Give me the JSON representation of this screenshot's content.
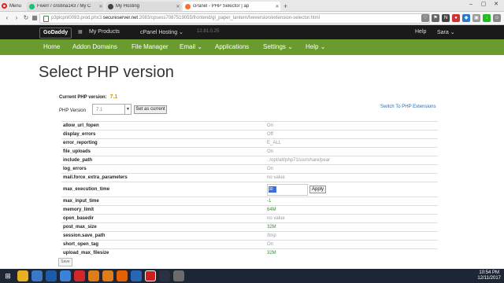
{
  "browser": {
    "menu_label": "Menu",
    "tabs": [
      {
        "label": "Fiverr / cristina143 / My C",
        "color": "#1dbf73",
        "active": false
      },
      {
        "label": "My Hosting",
        "color": "#444444",
        "active": false
      },
      {
        "label": "cPanel - PHP Selector | ap",
        "color": "#ff6c2c",
        "active": true
      }
    ],
    "url_prefix": "p3plcpnl0093.prod.phx3.",
    "url_host": "secureserver.net",
    "url_rest": ":2083/cpsess7087519055/frontend/gl_paper_lantern/lveversion/extension-selector.html"
  },
  "cpanel_top": {
    "logo": "GoDaddy",
    "my_products": "My Products",
    "hosting": "cPanel Hosting",
    "version": "12.81.0.25",
    "help": "Help",
    "user": "Sara"
  },
  "nav": [
    "Home",
    "Addon Domains",
    "File Manager",
    "Email",
    "Applications",
    "Settings",
    "Help"
  ],
  "page": {
    "title": "Select PHP version",
    "current_label": "Current PHP version:",
    "current_value": "7.1",
    "php_version_label": "PHP Version",
    "php_version_selected": "7.1",
    "set_current_label": "Set as current",
    "switch_link": "Switch To PHP Extensions",
    "apply_label": "Apply",
    "editing_value": "30",
    "save_label": "Save"
  },
  "options": [
    {
      "name": "allow_url_fopen",
      "value": "On"
    },
    {
      "name": "display_errors",
      "value": "Off"
    },
    {
      "name": "error_reporting",
      "value": "E_ALL"
    },
    {
      "name": "file_uploads",
      "value": "On"
    },
    {
      "name": "include_path",
      "value": ".:/opt/alt/php71/usr/share/pear"
    },
    {
      "name": "log_errors",
      "value": "On"
    },
    {
      "name": "mail.force_extra_parameters",
      "value": "no value"
    },
    {
      "name": "max_execution_time",
      "value": ""
    },
    {
      "name": "max_input_time",
      "value": "-1"
    },
    {
      "name": "memory_limit",
      "value": "64M"
    },
    {
      "name": "open_basedir",
      "value": "no value"
    },
    {
      "name": "post_max_size",
      "value": "32M"
    },
    {
      "name": "session.save_path",
      "value": "/tmp"
    },
    {
      "name": "short_open_tag",
      "value": "On"
    },
    {
      "name": "upload_max_filesize",
      "value": "32M"
    }
  ],
  "taskbar": {
    "time": "10:54 PM",
    "date": "12/11/2017"
  }
}
